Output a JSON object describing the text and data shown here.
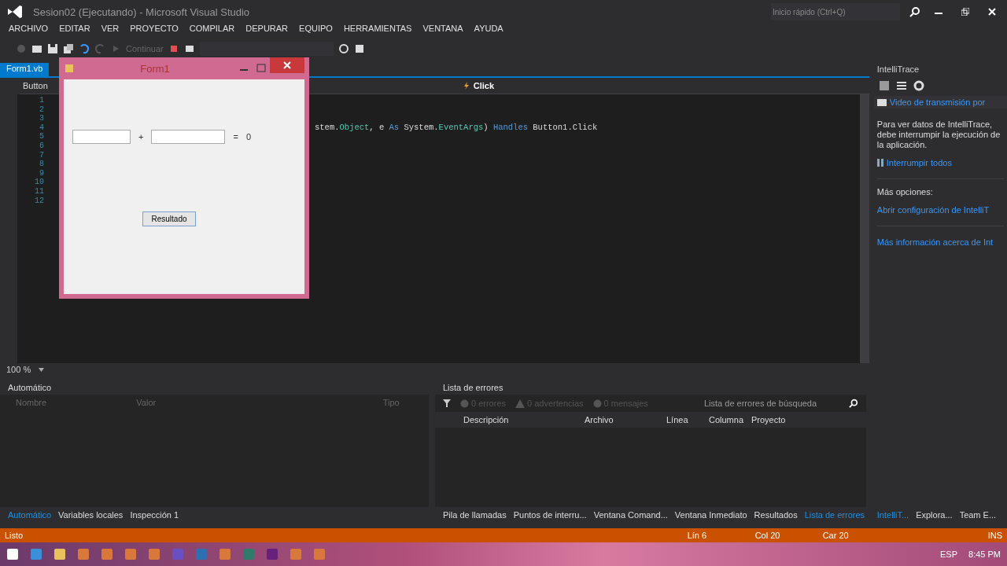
{
  "window": {
    "title": "Sesion02 (Ejecutando) - Microsoft Visual Studio",
    "quick_launch": {
      "placeholder": "Inicio rápido (Ctrl+Q)"
    }
  },
  "menu": [
    "ARCHIVO",
    "EDITAR",
    "VER",
    "PROYECTO",
    "COMPILAR",
    "DEPURAR",
    "EQUIPO",
    "HERRAMIENTAS",
    "VENTANA",
    "AYUDA"
  ],
  "toolbar": {
    "continue_label": "Continuar"
  },
  "document_tabs": [
    {
      "label": "Form1.vb",
      "selected": true
    }
  ],
  "nav_bar": {
    "left": "Button",
    "right": "Click"
  },
  "code": {
    "lines": [
      {
        "number": "1"
      },
      {
        "number": "2"
      },
      {
        "number": "3"
      },
      {
        "number": "4",
        "segments": [
          {
            "kind": "plain",
            "text": "stem."
          },
          {
            "kind": "type",
            "text": "Object"
          },
          {
            "kind": "plain",
            "text": ", e "
          },
          {
            "kind": "keyword",
            "text": "As"
          },
          {
            "kind": "plain",
            "text": " System."
          },
          {
            "kind": "type",
            "text": "EventArgs"
          },
          {
            "kind": "plain",
            "text": ") "
          },
          {
            "kind": "keyword",
            "text": "Handles"
          },
          {
            "kind": "plain",
            "text": " Button1.Click"
          }
        ]
      },
      {
        "number": "5"
      },
      {
        "number": "6"
      },
      {
        "number": "7"
      },
      {
        "number": "8"
      },
      {
        "number": "9"
      },
      {
        "number": "10"
      },
      {
        "number": "11"
      },
      {
        "number": "12"
      }
    ]
  },
  "zoom": "100 %",
  "form_window": {
    "title": "Form1",
    "operator": "+",
    "equals": "=",
    "result": "0",
    "button": "Resultado"
  },
  "intellitrace": {
    "title": "IntelliTrace",
    "dropdown": "Video de transmisión por",
    "message": "Para ver datos de IntelliTrace, debe interrumpir la ejecución de la aplicación.",
    "break_link": "Interrumpir todos",
    "more_label": "Más opciones:",
    "links": [
      "Abrir configuración de IntelliT",
      "Más información acerca de Int"
    ]
  },
  "autos_panel": {
    "title": "Automático",
    "columns": [
      "Nombre",
      "Valor",
      "Tipo"
    ]
  },
  "error_list": {
    "title": "Lista de errores",
    "filters": [
      {
        "kind": "error",
        "label": "0 errores"
      },
      {
        "kind": "warning",
        "label": "0 advertencias"
      },
      {
        "kind": "message",
        "label": "0 mensajes"
      }
    ],
    "search": {
      "placeholder": "Lista de errores de búsqueda"
    },
    "columns": [
      "Descripción",
      "Archivo",
      "Línea",
      "Columna",
      "Proyecto"
    ]
  },
  "bottom_tabs_left": [
    {
      "label": "Automático",
      "selected": true
    },
    {
      "label": "Variables locales",
      "selected": false
    },
    {
      "label": "Inspección 1",
      "selected": false
    }
  ],
  "bottom_tabs_right": [
    {
      "label": "Pila de llamadas",
      "selected": false
    },
    {
      "label": "Puntos de interru...",
      "selected": false
    },
    {
      "label": "Ventana Comand...",
      "selected": false
    },
    {
      "label": "Ventana Inmediato",
      "selected": false
    },
    {
      "label": "Resultados",
      "selected": false
    },
    {
      "label": "Lista de errores",
      "selected": true
    }
  ],
  "side_tabs": [
    {
      "label": "IntelliT...",
      "selected": true
    },
    {
      "label": "Explora...",
      "selected": false
    },
    {
      "label": "Team E...",
      "selected": false
    }
  ],
  "status_bar": {
    "message": "Listo",
    "line": "Lín 6",
    "column": "Col 20",
    "char": "Car 20",
    "mode": "INS"
  },
  "taskbar": {
    "apps": [
      {
        "kind": "start"
      },
      {
        "kind": "browser"
      },
      {
        "kind": "folder"
      },
      {
        "kind": "app"
      },
      {
        "kind": "app"
      },
      {
        "kind": "app"
      },
      {
        "kind": "app"
      },
      {
        "kind": "ae"
      },
      {
        "kind": "ps"
      },
      {
        "kind": "app"
      },
      {
        "kind": "au"
      },
      {
        "kind": "vs"
      },
      {
        "kind": "app"
      },
      {
        "kind": "app"
      }
    ],
    "language": "ESP",
    "time": "8:45 PM"
  }
}
